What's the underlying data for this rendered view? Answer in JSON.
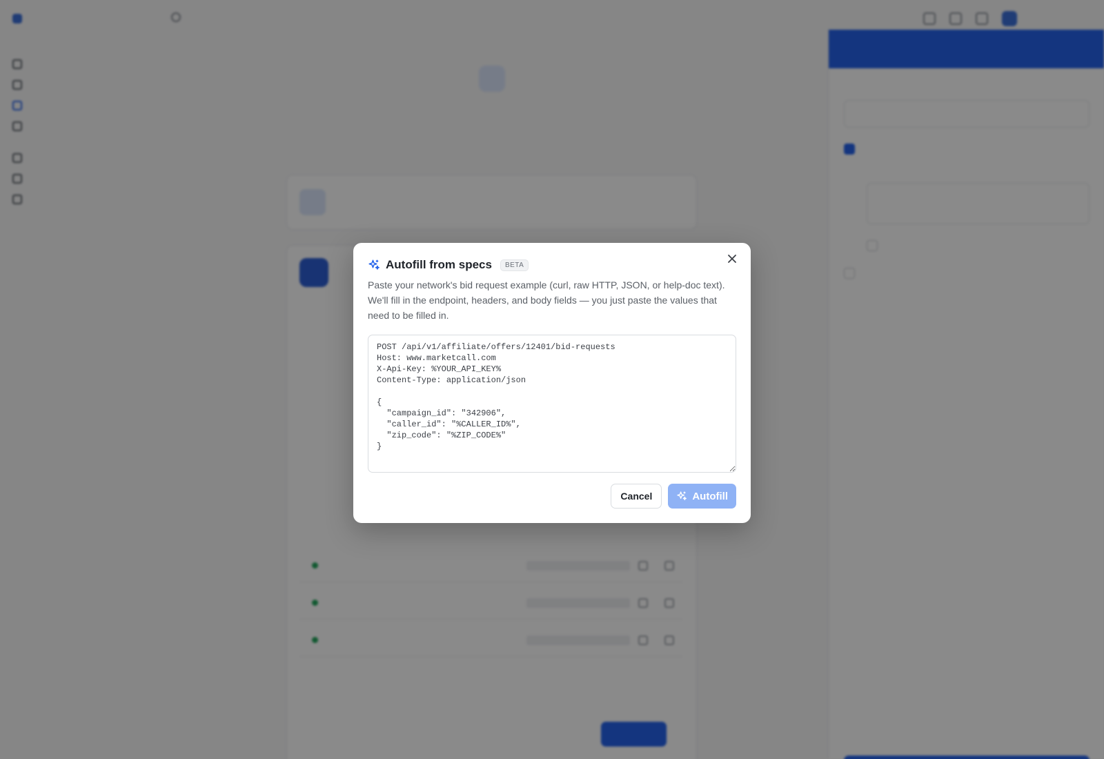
{
  "modal": {
    "title": "Autofill from specs",
    "badge": "BETA",
    "description": "Paste your network's bid request example (curl, raw HTTP, JSON, or help-doc text). We'll fill in the endpoint, headers, and body fields — you just paste the values that need to be filled in.",
    "textarea_value": "POST /api/v1/affiliate/offers/12401/bid-requests\nHost: www.marketcall.com\nX-Api-Key: %YOUR_API_KEY%\nContent-Type: application/json\n\n{\n  \"campaign_id\": \"342906\",\n  \"caller_id\": \"%CALLER_ID%\",\n  \"zip_code\": \"%ZIP_CODE%\"\n}",
    "cancel_label": "Cancel",
    "autofill_label": "Autofill",
    "icons": {
      "title": "sparkles-icon",
      "close": "close-icon",
      "autofill": "sparkles-icon"
    }
  },
  "colors": {
    "accent": "#2563eb",
    "autofill_disabled": "#8fb2f5",
    "overlay": "rgba(0,0,0,0.46)",
    "status_active": "#22a55b"
  }
}
